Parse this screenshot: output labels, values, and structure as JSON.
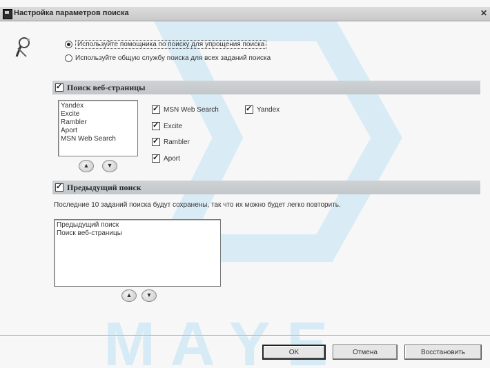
{
  "window": {
    "title": "Настройка параметров поиска",
    "close_glyph": "✕"
  },
  "mode_options": [
    {
      "label": "Используйте помощника по поиску для упрощения поиска",
      "selected": true
    },
    {
      "label": "Используйте общую службу поиска для всех заданий поиска",
      "selected": false
    }
  ],
  "web_search": {
    "title": "Поиск веб-страницы",
    "checked": true,
    "engine_list": [
      "Yandex",
      "Excite",
      "Rambler",
      "Aport",
      "MSN Web Search"
    ],
    "engines": [
      {
        "label": "MSN Web Search",
        "checked": true
      },
      {
        "label": "Yandex",
        "checked": true
      },
      {
        "label": "Excite",
        "checked": true
      },
      {
        "label": "Rambler",
        "checked": true
      },
      {
        "label": "Aport",
        "checked": true
      }
    ],
    "move_up_glyph": "▲",
    "move_down_glyph": "▼"
  },
  "previous_search": {
    "title": "Предыдущий поиск",
    "checked": true,
    "info": "Последние 10 заданий поиска будут сохранены, так что их можно будет легко повторить.",
    "items": [
      "Предыдущий поиск",
      "Поиск веб-страницы"
    ],
    "move_up_glyph": "▲",
    "move_down_glyph": "▼"
  },
  "buttons": {
    "ok": "OK",
    "cancel": "Отмена",
    "restore": "Восстановить"
  },
  "colors": {
    "section_bar": "#c6cacd",
    "watermark": "#cfe6f2"
  }
}
